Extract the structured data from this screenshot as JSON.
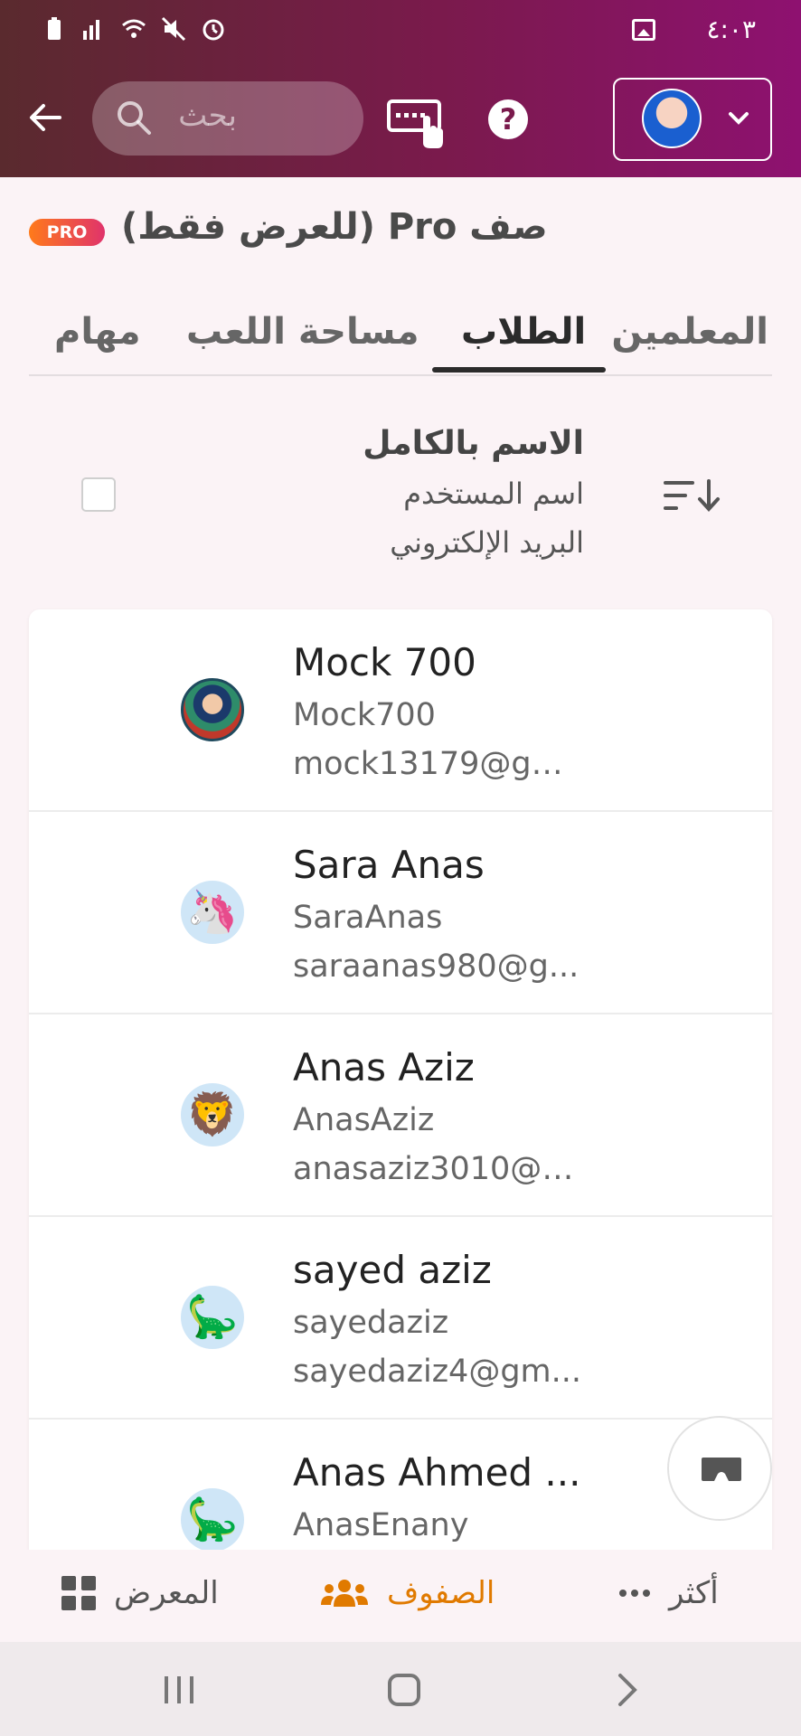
{
  "status_bar": {
    "time": "٤:٠٣"
  },
  "app_bar": {
    "search": {
      "placeholder": "بحث"
    },
    "icons": [
      "back-arrow-icon",
      "search-icon",
      "keyboard-icon",
      "help-icon",
      "chevron-down-icon"
    ]
  },
  "class": {
    "title": "صف Pro (للعرض فقط)",
    "badge": "PRO"
  },
  "tabs": [
    {
      "label": "المعلمين",
      "active": false
    },
    {
      "label": "الطلاب",
      "active": true
    },
    {
      "label": "مساحة اللعب",
      "active": false
    },
    {
      "label": "مهام",
      "active": false
    }
  ],
  "list_header": {
    "full_name": "الاسم بالكامل",
    "username": "اسم المستخدم",
    "email": "البريد الإلكتروني"
  },
  "students": [
    {
      "name": "Mock 700",
      "username": "Mock700",
      "email": "mock13179@gm...",
      "avatar": "photo"
    },
    {
      "name": "Sara Anas",
      "username": "SaraAnas",
      "email": "saraanas980@g...",
      "avatar": "unicorn"
    },
    {
      "name": "Anas Aziz",
      "username": "AnasAziz",
      "email": "anasaziz3010@g...",
      "avatar": "lion"
    },
    {
      "name": "sayed aziz",
      "username": "sayedaziz",
      "email": "sayedaziz4@gm...",
      "avatar": "dinosaur"
    },
    {
      "name": "Anas Ahmed ...",
      "username": "AnasEnany",
      "email": "",
      "avatar": "dinosaur"
    }
  ],
  "bottom_nav": [
    {
      "label": "المعرض",
      "icon": "grid-icon",
      "active": false
    },
    {
      "label": "الصفوف",
      "icon": "people-icon",
      "active": true
    },
    {
      "label": "أكثر",
      "icon": "more-icon",
      "active": false
    }
  ],
  "colors": {
    "accent": "#e07a00",
    "header_start": "#5a2a2e",
    "header_end": "#8e1170"
  }
}
